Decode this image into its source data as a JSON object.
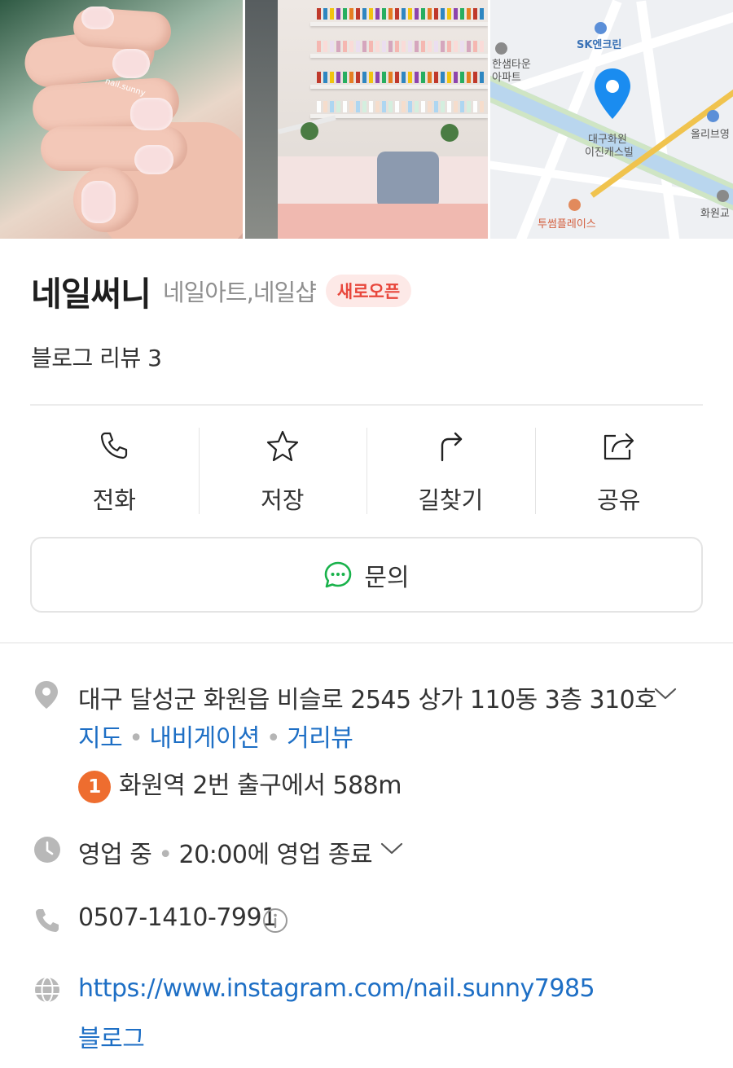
{
  "place": {
    "name": "네일써니",
    "category": "네일아트,네일샵",
    "badge": "새로오픈",
    "review_text": "블로그 리뷰 3"
  },
  "photos": {
    "watermark": "nail.sunny",
    "map_labels": {
      "sk": "SK엔크린",
      "hansaem": "한샘타운",
      "apart": "아파트",
      "pin_line1": "대구화원",
      "pin_line2": "이진캐스빌",
      "olive": "올리브영",
      "hwawon": "화원교",
      "twosome": "투썸플레이스"
    }
  },
  "actions": [
    {
      "label": "전화",
      "icon": "phone-icon"
    },
    {
      "label": "저장",
      "icon": "star-icon"
    },
    {
      "label": "길찾기",
      "icon": "directions-icon"
    },
    {
      "label": "공유",
      "icon": "share-icon"
    }
  ],
  "inquiry": {
    "label": "문의",
    "icon": "chat-icon"
  },
  "address": {
    "text": "대구 달성군 화원읍 비슬로 2545 상가 110동 3층 310호",
    "links": [
      "지도",
      "내비게이션",
      "거리뷰"
    ],
    "subway_line": "1",
    "subway_text": "화원역 2번 출구에서 588m"
  },
  "hours": {
    "status": "영업 중",
    "detail": "20:00에 영업 종료"
  },
  "phone": "0507-1410-7991",
  "website": {
    "url": "https://www.instagram.com/nail.sunny7985",
    "blog": "블로그"
  },
  "colors": {
    "badge_text": "#e8473c",
    "badge_bg": "#fde9e7",
    "link": "#1e6fc5",
    "subway_line1": "#ee6d2f",
    "chat_green": "#19b24b",
    "map_pin": "#1a8cf0"
  }
}
